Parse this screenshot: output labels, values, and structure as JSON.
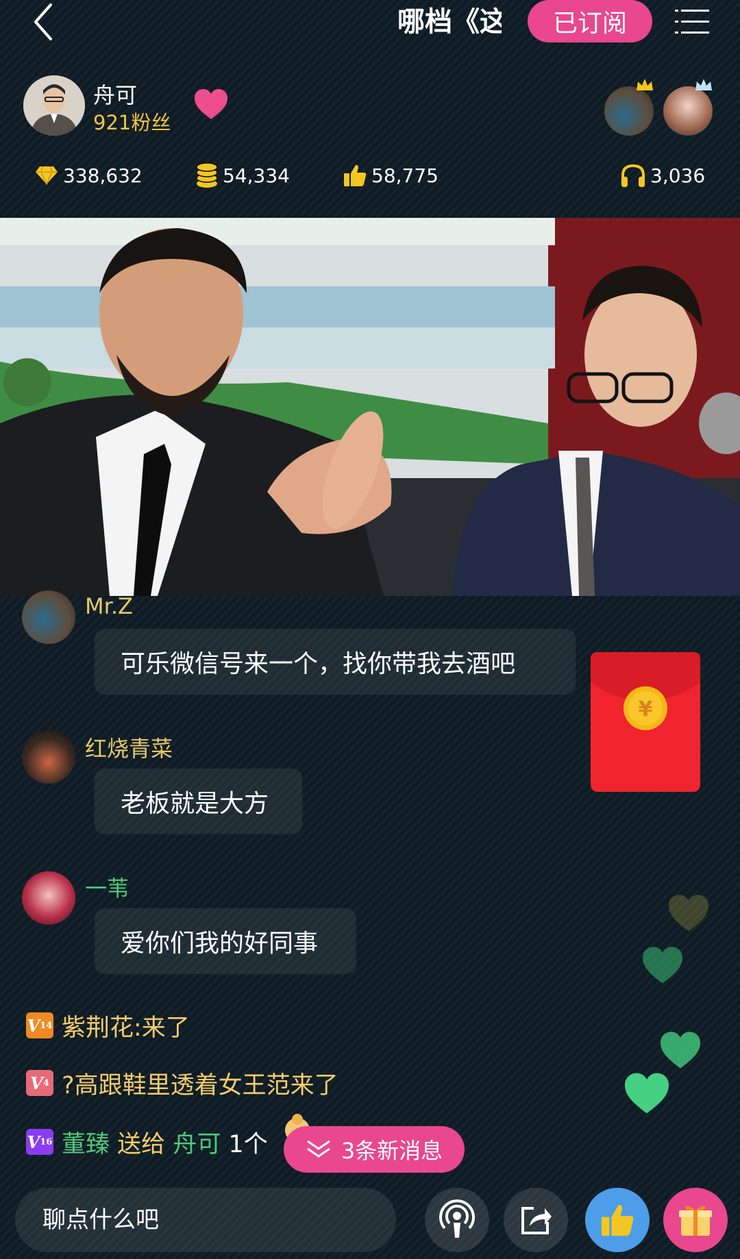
{
  "header": {
    "title": "哪档《这",
    "subscribe_label": "已订阅"
  },
  "host": {
    "name": "舟可",
    "fans": "921粉丝"
  },
  "stats": {
    "diamonds": "338,632",
    "coins": "54,334",
    "likes": "58,775",
    "listeners": "3,036"
  },
  "chat": [
    {
      "name": "Mr.Z",
      "message": "可乐微信号来一个，找你带我去酒吧"
    },
    {
      "name": "红烧青菜",
      "message": "老板就是大方"
    },
    {
      "name": "一苇",
      "message": "爱你们我的好同事"
    }
  ],
  "system_messages": [
    {
      "level": "14",
      "text": "紫荆花:来了",
      "badge_color": "#f08a24"
    },
    {
      "level": "4",
      "text": "?高跟鞋里透着女王范来了",
      "badge_color": "#e86a7a"
    },
    {
      "level": "16",
      "sender": "董臻",
      "action": "送给",
      "receiver": "舟可",
      "count": "1个",
      "badge_color": "#8a3cf0"
    }
  ],
  "new_messages_label": "3条新消息",
  "input": {
    "placeholder": "聊点什么吧"
  },
  "colors": {
    "accent_pink": "#e9478e",
    "gold": "#f1c447",
    "green": "#4fc97b",
    "like_blue": "#4d9de8"
  },
  "icons": [
    "back-icon",
    "menu-icon",
    "heart-icon",
    "crown-icon",
    "diamond-icon",
    "coin-icon",
    "thumbs-up-icon",
    "headphones-icon",
    "red-envelope-icon",
    "chevron-down-icon",
    "podcast-icon",
    "share-icon",
    "gift-icon"
  ]
}
